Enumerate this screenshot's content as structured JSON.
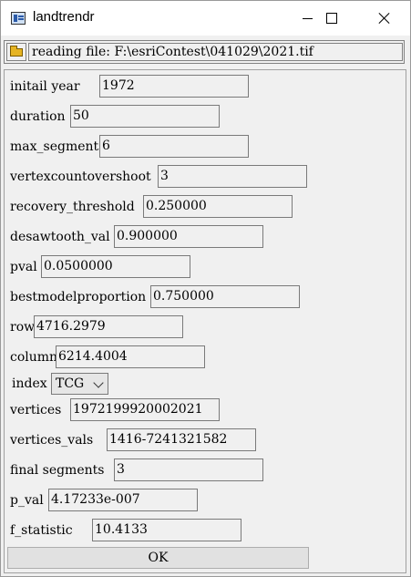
{
  "window": {
    "title": "landtrendr"
  },
  "file": {
    "text": "reading file: F:\\esriContest\\041029\\2021.tif"
  },
  "fields": {
    "initail_year": {
      "label": "initail year",
      "value": "1972"
    },
    "duration": {
      "label": "duration",
      "value": "50"
    },
    "max_segments": {
      "label": "max_segments",
      "value": "6"
    },
    "vertexcountovershoot": {
      "label": "vertexcountovershoot",
      "value": "3"
    },
    "recovery_threshold": {
      "label": "recovery_threshold",
      "value": "0.250000"
    },
    "desawtooth_val": {
      "label": "desawtooth_val",
      "value": "0.900000"
    },
    "pval": {
      "label": "pval",
      "value": "0.0500000"
    },
    "bestmodelproportion": {
      "label": "bestmodelproportion",
      "value": "0.750000"
    },
    "row": {
      "label": "row",
      "value": "4716.2979"
    },
    "column": {
      "label": "column",
      "value": "6214.4004"
    },
    "index": {
      "label": "index",
      "value": "TCG"
    },
    "vertices": {
      "label": "vertices",
      "value": "1972199920002021"
    },
    "vertices_vals": {
      "label": "vertices_vals",
      "value": "1416-7241321582"
    },
    "final_segments": {
      "label": "final segments",
      "value": "3"
    },
    "p_val": {
      "label": "p_val",
      "value": "4.17233e-007"
    },
    "f_statistic": {
      "label": "f_statistic",
      "value": "10.4133"
    }
  },
  "buttons": {
    "ok": "OK"
  }
}
